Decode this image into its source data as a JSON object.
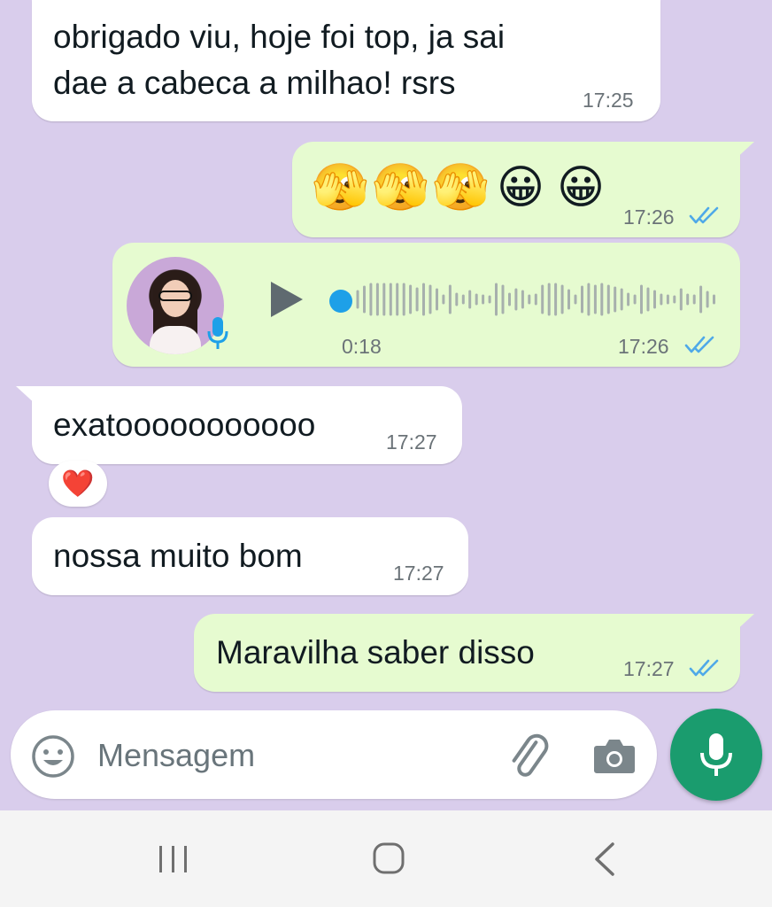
{
  "messages": [
    {
      "direction": "incoming",
      "text": "obrigado viu, hoje foi top, ja sai\ndae a cabeca a milhao! rsrs",
      "time": "17:25"
    },
    {
      "direction": "outgoing",
      "emojis": [
        "🫣",
        "🫣",
        "🫣",
        "😀",
        "😀"
      ],
      "emoji_names": [
        "face-with-peeking-eye",
        "face-with-peeking-eye",
        "face-with-peeking-eye",
        "grinning-face",
        "grinning-face"
      ],
      "time": "17:26",
      "read": true
    },
    {
      "direction": "outgoing",
      "type": "voice",
      "duration": "0:18",
      "time": "17:26",
      "read": true,
      "progress": 0
    },
    {
      "direction": "incoming",
      "text": "exatooooooooooo",
      "time": "17:27",
      "reaction": "❤️"
    },
    {
      "direction": "incoming",
      "text": "nossa muito bom",
      "time": "17:27"
    },
    {
      "direction": "outgoing",
      "text": "Maravilha saber disso",
      "time": "17:27",
      "read": true
    }
  ],
  "composer": {
    "placeholder": "Mensagem",
    "icons": [
      "emoji-icon",
      "paperclip-icon",
      "camera-icon",
      "mic-icon"
    ]
  },
  "navbar": {
    "icons": [
      "recent-apps-icon",
      "home-icon",
      "back-icon"
    ]
  },
  "colors": {
    "background": "#d9cdec",
    "incoming_bubble": "#ffffff",
    "outgoing_bubble": "#e6fbd0",
    "read_ticks": "#4fa9e8",
    "fab": "#1a9c6e"
  }
}
